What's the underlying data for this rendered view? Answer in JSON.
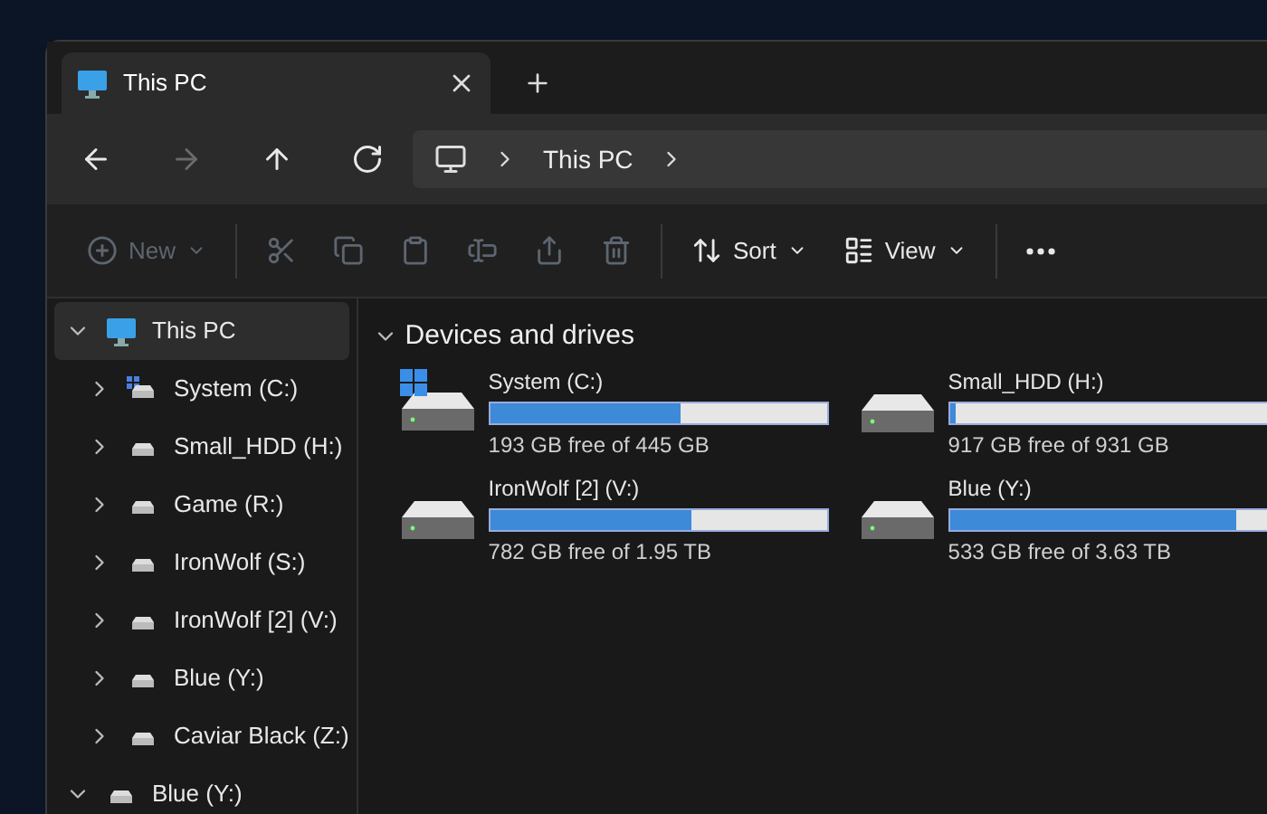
{
  "tab": {
    "title": "This PC",
    "selected": true
  },
  "nav": [
    {
      "kind": "back",
      "disabled": false
    },
    {
      "kind": "forward",
      "disabled": true
    },
    {
      "kind": "up",
      "disabled": false
    },
    {
      "kind": "refresh",
      "disabled": false
    }
  ],
  "address": {
    "segments": [
      "This PC"
    ]
  },
  "toolbar": [
    {
      "kind": "new",
      "label": "New",
      "disabled": true
    },
    {
      "kind": "cut",
      "disabled": true
    },
    {
      "kind": "copy",
      "disabled": true
    },
    {
      "kind": "paste",
      "disabled": true
    },
    {
      "kind": "rename",
      "disabled": true
    },
    {
      "kind": "share",
      "disabled": true
    },
    {
      "kind": "delete",
      "disabled": true
    },
    {
      "kind": "sort",
      "label": "Sort",
      "disabled": false
    },
    {
      "kind": "view",
      "label": "View",
      "disabled": false
    },
    {
      "kind": "more",
      "disabled": false
    }
  ],
  "sidebar": {
    "items": [
      {
        "label": "This PC",
        "kind": "pc",
        "expanded": true,
        "selected": true,
        "children": [
          {
            "label": "System (C:)",
            "kind": "system",
            "expanded": false,
            "selected": false
          },
          {
            "label": "Small_HDD (H:)",
            "kind": "drive",
            "expanded": false,
            "selected": false
          },
          {
            "label": "Game (R:)",
            "kind": "drive",
            "expanded": false,
            "selected": false
          },
          {
            "label": "IronWolf (S:)",
            "kind": "drive",
            "expanded": false,
            "selected": false
          },
          {
            "label": "IronWolf [2] (V:)",
            "kind": "drive",
            "expanded": false,
            "selected": false
          },
          {
            "label": "Blue (Y:)",
            "kind": "drive",
            "expanded": false,
            "selected": false
          },
          {
            "label": "Caviar Black (Z:)",
            "kind": "drive",
            "expanded": false,
            "selected": false
          }
        ]
      },
      {
        "label": "Blue (Y:)",
        "kind": "drive",
        "expanded": true,
        "selected": false
      }
    ]
  },
  "section": {
    "title": "Devices and drives",
    "expanded": true,
    "drives": [
      {
        "name": "System (C:)",
        "kind": "system",
        "level": 0.566,
        "free": "193 GB free of 445 GB"
      },
      {
        "name": "Small_HDD (H:)",
        "kind": "drive",
        "level": 0.015,
        "free": "917 GB free of 931 GB"
      },
      {
        "name": "IronWolf [2] (V:)",
        "kind": "drive",
        "level": 0.6,
        "free": "782 GB free of 1.95 TB"
      },
      {
        "name": "Blue (Y:)",
        "kind": "drive",
        "level": 0.853,
        "free": "533 GB free of 3.63 TB"
      }
    ]
  }
}
